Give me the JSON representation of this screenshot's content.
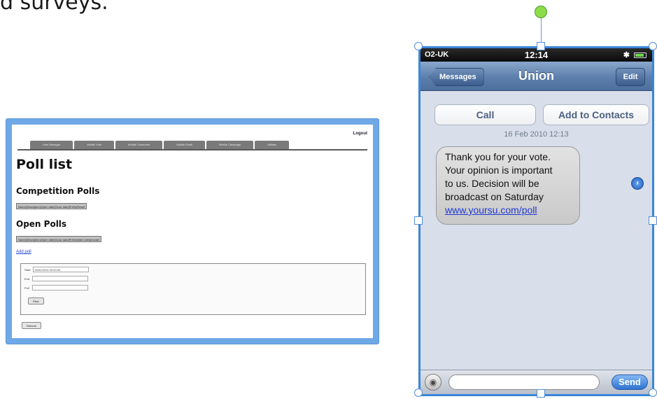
{
  "slide_heading": "d surveys.",
  "poll_page": {
    "logout": "Logout",
    "tabs": [
      "User Manager",
      "Mobile Vote",
      "Mobile Consumer",
      "Mobile Email",
      "Mobile Campaign",
      "Utilities"
    ],
    "title": "Poll list",
    "competition_heading": "Competition Polls",
    "competition_columns": "Name|Description|Open date|Close date|Prefix|Result",
    "open_heading": "Open Polls",
    "open_columns": "Name|Description|Open date|Close date|Prefix|Valid votes|Invalid",
    "add_poll": "Add poll",
    "filter": {
      "start_label": "Start",
      "start_value": "09/02/2010 00:00:00",
      "end_label": "End",
      "end_value": "",
      "poll_label": "Poll",
      "poll_value": "",
      "filter_button": "Filter"
    },
    "refresh_button": "Refresh"
  },
  "phone": {
    "carrier": "O2-UK",
    "time": "12:14",
    "bluetooth": "✱",
    "back_button": "Messages",
    "title": "Union",
    "edit_button": "Edit",
    "call_button": "Call",
    "add_contacts_button": "Add to Contacts",
    "message_date": "16 Feb 2010 12:13",
    "message_lines": [
      "Thank you for your vote.",
      "Your opinion is important",
      "to us. Decision will be",
      "broadcast on Saturday"
    ],
    "message_link": "www.yoursu.com/poll",
    "detail_glyph": "›",
    "camera_glyph": "◉",
    "send_button": "Send"
  }
}
